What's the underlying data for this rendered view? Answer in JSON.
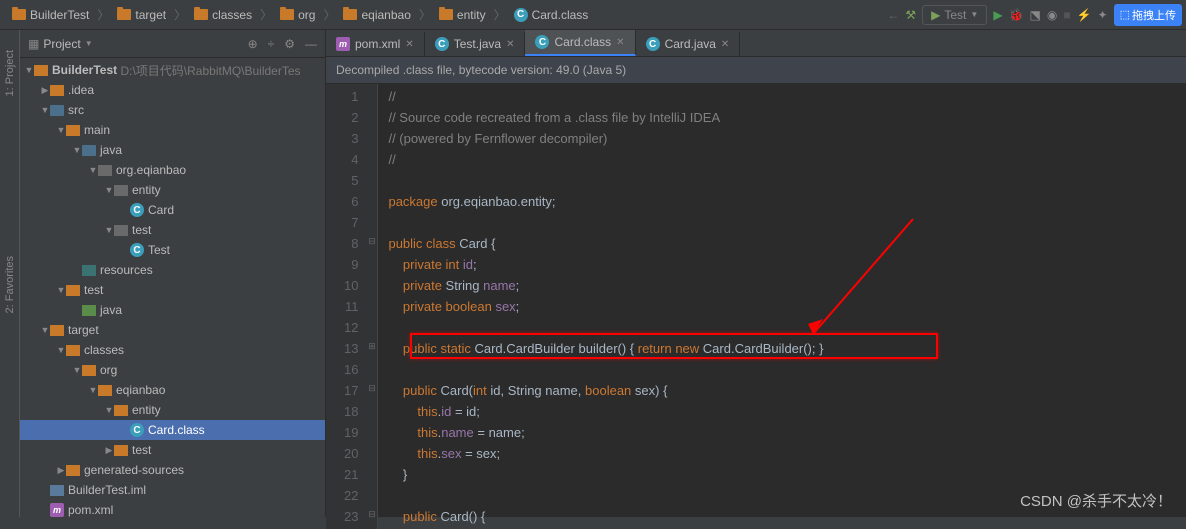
{
  "breadcrumb": [
    "BuilderTest",
    "target",
    "classes",
    "org",
    "eqianbao",
    "entity",
    "Card.class"
  ],
  "run_config": "Test",
  "upload_btn": "拖拽上传",
  "left_rail": {
    "project": "1: Project",
    "favorites": "2: Favorites"
  },
  "panel": {
    "title": "Project"
  },
  "tree": {
    "root": "BuilderTest",
    "root_path": "D:\\项目代码\\RabbitMQ\\BuilderTes",
    "idea": ".idea",
    "src": "src",
    "main": "main",
    "java": "java",
    "pkg": "org.eqianbao",
    "entity": "entity",
    "card": "Card",
    "testdir": "test",
    "testclass": "Test",
    "resources": "resources",
    "test2": "test",
    "java2": "java",
    "target": "target",
    "classes": "classes",
    "org": "org",
    "eqianbao": "eqianbao",
    "entity2": "entity",
    "cardclass": "Card.class",
    "testfolder": "test",
    "gensrc": "generated-sources",
    "iml": "BuilderTest.iml",
    "pom": "pom.xml"
  },
  "tabs": [
    {
      "label": "pom.xml",
      "type": "m"
    },
    {
      "label": "Test.java",
      "type": "c"
    },
    {
      "label": "Card.class",
      "type": "c",
      "active": true
    },
    {
      "label": "Card.java",
      "type": "c"
    }
  ],
  "banner": "Decompiled .class file, bytecode version: 49.0 (Java 5)",
  "code": {
    "l1": "//",
    "l2": "// Source code recreated from a .class file by IntelliJ IDEA",
    "l3": "// (powered by Fernflower decompiler)",
    "l6a": "package ",
    "l6b": "org.eqianbao.entity;",
    "l8a": "public class ",
    "l8b": "Card {",
    "l9a": "    private int ",
    "l9b": "id",
    "l10a": "    private ",
    "l10b": "String ",
    "l10c": "name",
    "l11a": "    private boolean ",
    "l11b": "sex",
    "l13a": "    public static ",
    "l13b": "Card.CardBuilder builder() { ",
    "l13c": "return new ",
    "l13d": "Card.CardBuilder(); }",
    "l17a": "    public ",
    "l17b": "Card(",
    "l17c": "int ",
    "l17d": "id, String name, ",
    "l17e": "boolean ",
    "l17f": "sex) {",
    "l18a": "        this",
    ".l18b": ".",
    "l18c": "id ",
    "l18d": "= id;",
    "l19a": "        this",
    "l19b": ".",
    "l19c": "name ",
    "l19d": "= name;",
    "l20a": "        this",
    "l20b": ".",
    "l20c": "sex ",
    "l20d": "= sex;",
    "l21": "    }",
    "l23a": "    public ",
    "l23b": "Card() {"
  },
  "watermark": "CSDN @杀手不太冷！"
}
